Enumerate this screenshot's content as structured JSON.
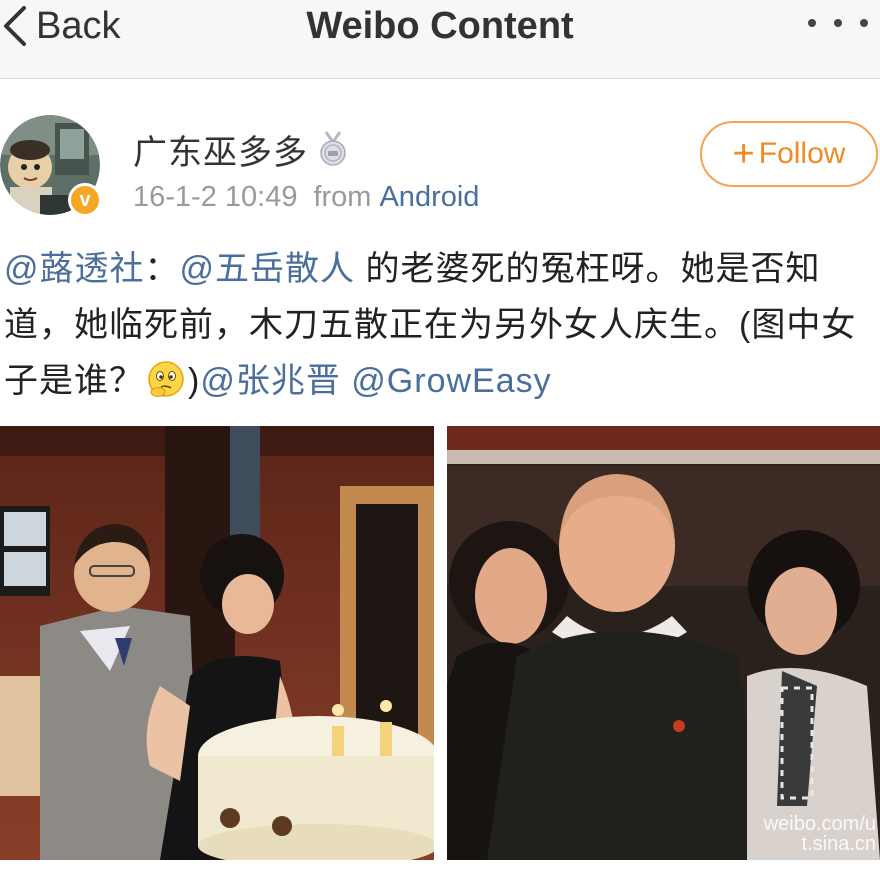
{
  "nav": {
    "back_label": "Back",
    "title": "Weibo Content",
    "back_icon": "chevron-left-icon",
    "more_icon": "more-dots-icon"
  },
  "post": {
    "author": "广东巫多多",
    "author_badge_icon": "medal-icon",
    "verified_icon": "verified-v-icon",
    "verified_mark": "v",
    "timestamp": "16-1-2 10:49",
    "from_label": "from",
    "source": "Android",
    "follow_label": "Follow",
    "follow_icon": "plus-icon",
    "body": {
      "mention_1": "@蕗透社",
      "sep_1": "：",
      "mention_2": "@五岳散人",
      "text_1": " 的老婆死的冤枉呀。她是否知道，她临死前，木刀五散正在为另外女人庆生。(图中女子是谁？",
      "emoji": "thinking-face-icon",
      "text_2": ")",
      "mention_3": "@张兆晋",
      "space": " ",
      "mention_4": "@GrowEasy"
    }
  },
  "photos": [
    {
      "name": "birthday-cake-photo"
    },
    {
      "name": "group-photo",
      "watermark_line_1": "weibo.com/u",
      "watermark_line_2": "t.sina.cn"
    }
  ],
  "colors": {
    "link": "#4a6f9c",
    "follow_accent": "#f08a24",
    "meta_gray": "#9a9a9a",
    "nav_bg": "#f7f7f7"
  }
}
